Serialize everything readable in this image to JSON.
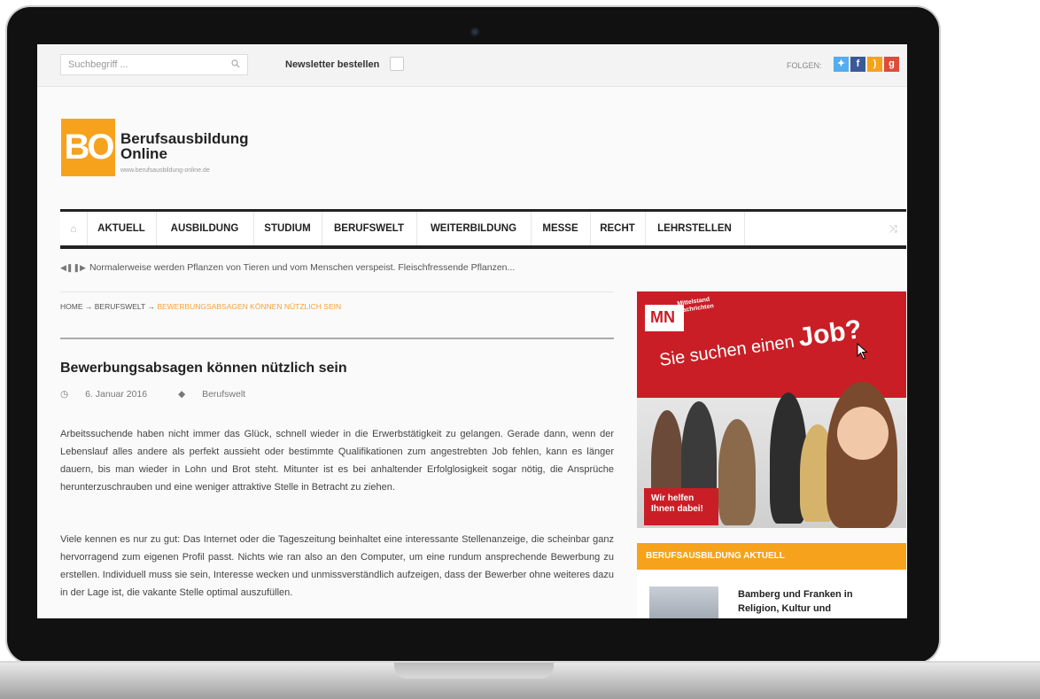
{
  "search": {
    "placeholder": "Suchbegriff ..."
  },
  "topbar": {
    "newsletter_label": "Newsletter bestellen",
    "follow_label": "FOLGEN:"
  },
  "social": [
    "twitter-icon",
    "facebook-icon",
    "rss-icon",
    "googleplus-icon"
  ],
  "logo": {
    "mark": "BO",
    "title_line1": "Berufsausbildung",
    "title_line2": "Online",
    "url": "www.berufsausbildung-online.de"
  },
  "nav": {
    "items": [
      "AKTUELL",
      "AUSBILDUNG",
      "STUDIUM",
      "BERUFSWELT",
      "WEITERBILDUNG",
      "MESSE",
      "RECHT",
      "LEHRSTELLEN"
    ]
  },
  "ticker": {
    "text": "Normalerweise werden Pflanzen von Tieren und vom Menschen verspeist. Fleischfressende Pflanzen..."
  },
  "breadcrumb": {
    "home": "HOME",
    "section": "BERUFSWELT",
    "current": "BEWERBUNGSABSAGEN KÖNNEN NÜTZLICH SEIN",
    "sep": "→"
  },
  "article": {
    "title": "Bewerbungsabsagen können nützlich sein",
    "date": "6. Januar 2016",
    "category": "Berufswelt",
    "p1": "Arbeitssuchende haben nicht immer das Glück, schnell wieder in die Erwerbstätigkeit zu gelangen. Gerade dann, wenn der Lebenslauf alles andere als perfekt aussieht oder bestimmte Qualifikationen zum angestrebten Job fehlen, kann es länger dauern, bis man wieder in Lohn und Brot steht. Mitunter ist es bei anhaltender Erfolglosigkeit sogar nötig, die Ansprüche herunterzuschrauben und eine weniger attraktive Stelle in Betracht zu ziehen.",
    "p2": "Viele kennen es nur zu gut: Das Internet oder die Tageszeitung beinhaltet eine interessante Stellenanzeige, die scheinbar ganz hervorragend zum eigenen Profil passt. Nichts wie ran also an den Computer, um eine rundum ansprechende Bewerbung zu erstellen. Individuell muss sie sein, Interesse wecken und unmissverständlich aufzeigen, dass der Bewerber ohne weiteres dazu in der Lage ist, die vakante Stelle optimal auszufüllen."
  },
  "ad": {
    "brand_short": "MN",
    "brand_line1": "Mittelstand",
    "brand_line2": "Nachrichten",
    "headline": "Sie suchen einen",
    "headline_strong": "Job?",
    "cta_line1": "Wir helfen",
    "cta_line2": "Ihnen dabei!"
  },
  "widget": {
    "title": "BERUFSAUSBILDUNG AKTUELL",
    "item_title": "Bamberg und Franken in Religion, Kultur und"
  },
  "colors": {
    "accent": "#f7a21c",
    "ad_red": "#c91e26",
    "twitter": "#55acee",
    "facebook": "#3b5998",
    "rss": "#f7a21c",
    "googleplus": "#dd4b39"
  }
}
